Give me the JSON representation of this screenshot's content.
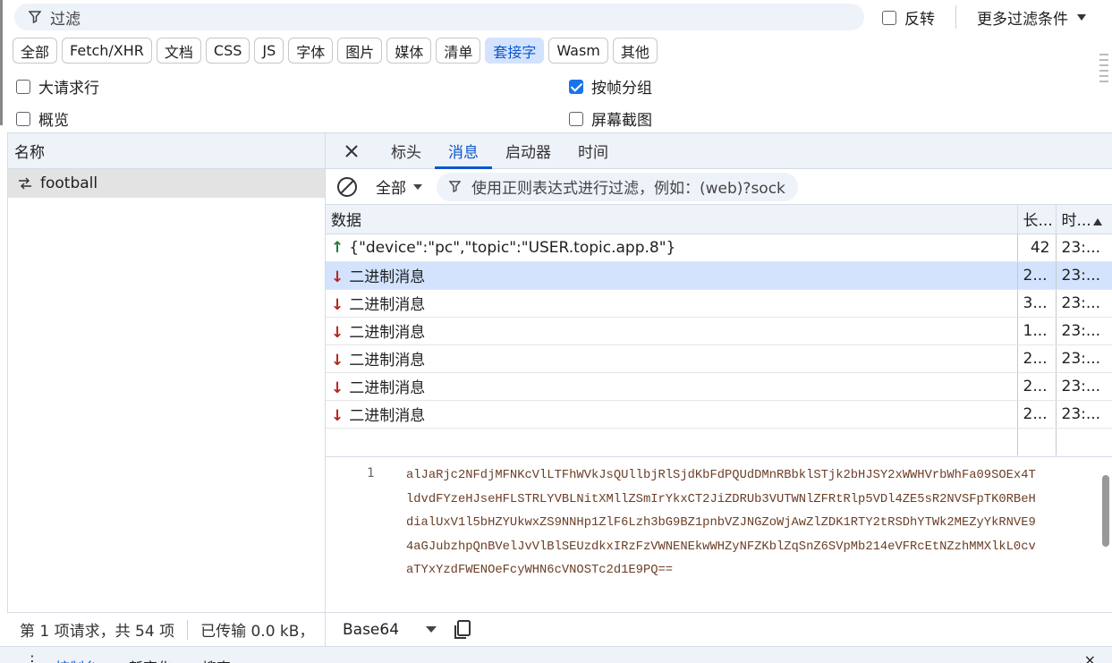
{
  "filter": {
    "placeholder": "过滤",
    "invert_label": "反转",
    "more_filters_label": "更多过滤条件"
  },
  "type_chips": [
    "全部",
    "Fetch/XHR",
    "文档",
    "CSS",
    "JS",
    "字体",
    "图片",
    "媒体",
    "清单",
    "套接字",
    "Wasm",
    "其他"
  ],
  "active_chip": "套接字",
  "options": {
    "big_rows": {
      "label": "大请求行",
      "checked": false
    },
    "group_by_frame": {
      "label": "按帧分组",
      "checked": true
    },
    "overview": {
      "label": "概览",
      "checked": false
    },
    "screenshots": {
      "label": "屏幕截图",
      "checked": false
    }
  },
  "left_panel": {
    "header": "名称",
    "items": [
      {
        "name": "football"
      }
    ]
  },
  "detail_tabs": [
    "标头",
    "消息",
    "启动器",
    "时间"
  ],
  "active_tab": "消息",
  "msg_toolbar": {
    "type_select": "全部",
    "regex_placeholder": "使用正则表达式进行过滤，例如：(web)?sock"
  },
  "messages_table": {
    "columns": [
      "数据",
      "长...",
      "时..."
    ],
    "rows": [
      {
        "dir": "up",
        "data": "{\"device\":\"pc\",\"topic\":\"USER.topic.app.8\"}",
        "length": "42",
        "time": "23:..."
      },
      {
        "dir": "down",
        "data": "二进制消息",
        "length": "2...",
        "time": "23:...",
        "selected": true
      },
      {
        "dir": "down",
        "data": "二进制消息",
        "length": "3...",
        "time": "23:..."
      },
      {
        "dir": "down",
        "data": "二进制消息",
        "length": "1...",
        "time": "23:..."
      },
      {
        "dir": "down",
        "data": "二进制消息",
        "length": "2...",
        "time": "23:..."
      },
      {
        "dir": "down",
        "data": "二进制消息",
        "length": "2...",
        "time": "23:..."
      },
      {
        "dir": "down",
        "data": "二进制消息",
        "length": "2...",
        "time": "23:..."
      }
    ]
  },
  "payload": {
    "line_number": "1",
    "lines": [
      "alJaRjc2NFdjMFNKcVlLTFhWVkJsQUllbjRlSjdKbFdPQUdDMnRBbklSTjk2bHJSY2xWWHVrbWhFa09SOEx4T",
      "ldvdFYzeHJseHFLSTRLYVBLNitXMllZSmIrYkxCT2JiZDRUb3VUTWNlZFRtRlp5VDl4ZE5sR2NVSFpTK0RBeH",
      "dialUxV1l5bHZYUkwxZS9NNHp1ZlF6Lzh3bG9BZ1pnbVZJNGZoWjAwZlZDK1RTY2tRSDhYTWk2MEZyYkRNVE9",
      "4aGJubzhpQnBVelJvVlBlSEUzdkxIRzFzVWNENEkwWHZyNFZKblZqSnZ6SVpMb214eVFRcEtNZzhMMXlkL0cv",
      "aTYxYzdFWENOeFcyWHN6cVNOSTc2d1E9PQ=="
    ],
    "encoding": "Base64"
  },
  "status": {
    "requests": "第 1 项请求，共 54 项",
    "transferred": "已传输 0.0 kB，"
  },
  "drawer": {
    "dots": "⋮",
    "tabs": [
      "控制台",
      "新变化",
      "搜索"
    ],
    "close": "×"
  },
  "colors": {
    "accent": "#0b57d0",
    "chip_active_bg": "#d3e3fd",
    "selected_row": "#d3e3fd",
    "arrow_up": "#188038",
    "arrow_down": "#b3261e"
  }
}
